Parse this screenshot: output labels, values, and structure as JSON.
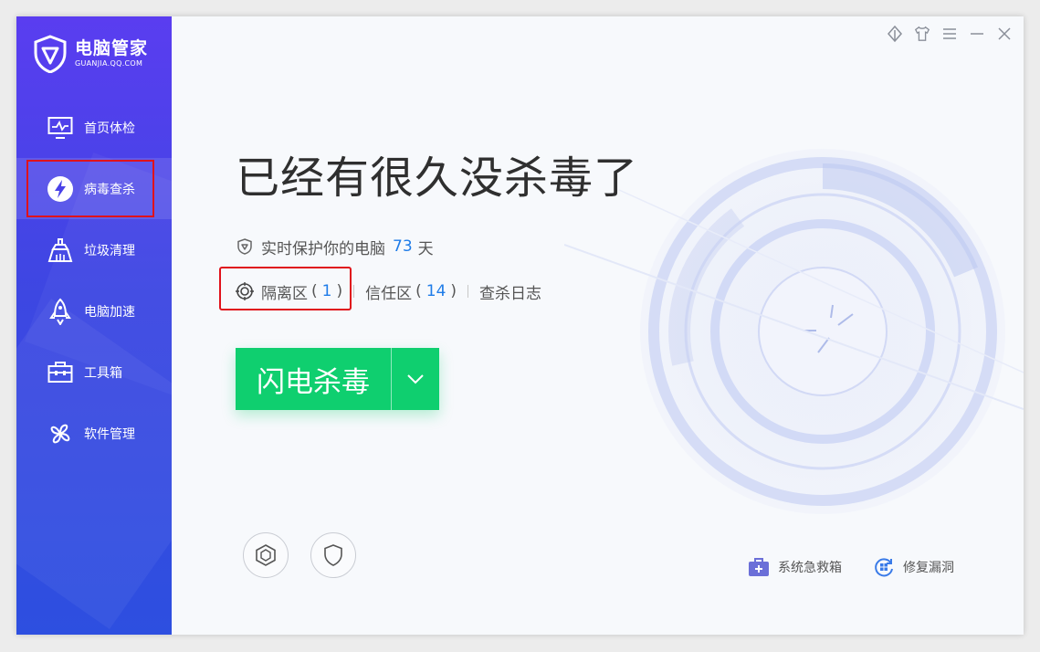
{
  "app": {
    "title": "电脑管家",
    "subtitle": "GUANJIA.QQ.COM",
    "accent": "#0fcf6f",
    "brand_color": "#4a42e8",
    "link_color": "#1f7ce8"
  },
  "sidebar": {
    "items": [
      {
        "label": "首页体检",
        "icon": "monitor-icon"
      },
      {
        "label": "病毒查杀",
        "icon": "lightning-icon",
        "active": true
      },
      {
        "label": "垃圾清理",
        "icon": "broom-icon"
      },
      {
        "label": "电脑加速",
        "icon": "rocket-icon"
      },
      {
        "label": "工具箱",
        "icon": "toolbox-icon"
      },
      {
        "label": "软件管理",
        "icon": "apps-icon"
      }
    ]
  },
  "window_controls": [
    "skin-icon",
    "shirt-icon",
    "menu-icon",
    "minimize-icon",
    "close-icon"
  ],
  "main": {
    "headline": "已经有很久没杀毒了",
    "protect": {
      "prefix": "实时保护你的电脑",
      "days": "73",
      "suffix": "天"
    },
    "links": {
      "quarantine": {
        "label": "隔离区",
        "open": "(",
        "count": "1",
        "close": ")"
      },
      "trust": {
        "label": "信任区",
        "open": "(",
        "count": "14",
        "close": ")"
      },
      "log": {
        "label": "查杀日志"
      }
    },
    "scan_button": {
      "label": "闪电杀毒"
    },
    "bottom_icons": [
      "settings-hex-icon",
      "shield-icon"
    ],
    "tools": [
      {
        "label": "系统急救箱",
        "icon": "first-aid-kit-icon"
      },
      {
        "label": "修复漏洞",
        "icon": "repair-icon"
      }
    ]
  }
}
